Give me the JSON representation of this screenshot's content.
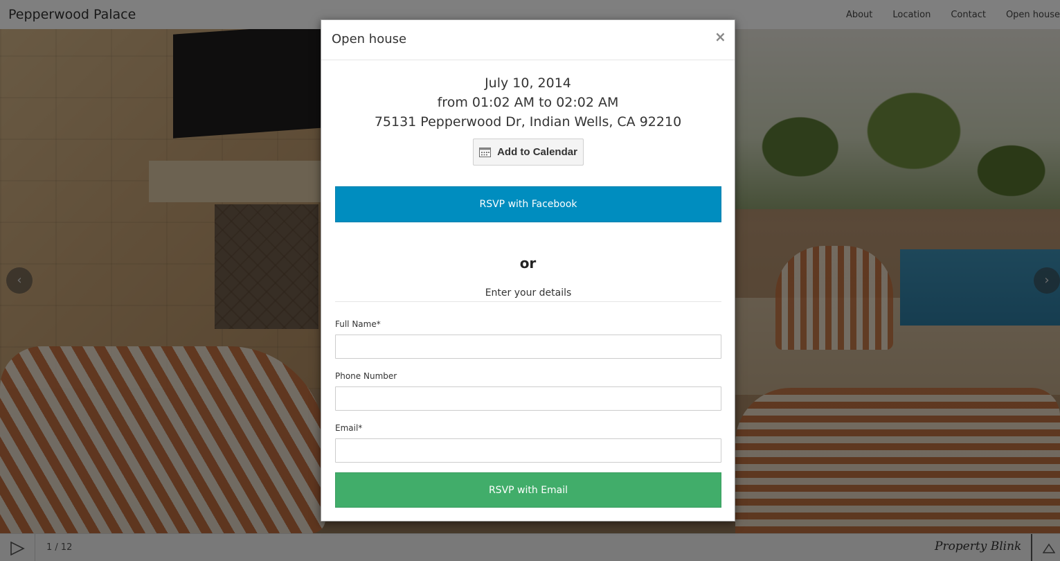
{
  "navbar": {
    "brand": "Pepperwood Palace",
    "links": [
      "About",
      "Location",
      "Contact",
      "Open house"
    ]
  },
  "slideshow": {
    "counter": "1 / 12",
    "brandmark": "Property Blink",
    "prev_icon": "chevron-left-icon",
    "next_icon": "chevron-right-icon"
  },
  "modal": {
    "title": "Open house",
    "close_symbol": "×",
    "date": "July 10, 2014",
    "time": "from 01:02 AM to 02:02 AM",
    "address": "75131 Pepperwood Dr, Indian Wells, CA 92210",
    "calendar_button": "Add to Calendar",
    "facebook_button": "RSVP with Facebook",
    "or_text": "or",
    "details_heading": "Enter your details",
    "fields": {
      "full_name": {
        "label": "Full Name*",
        "value": ""
      },
      "phone": {
        "label": "Phone Number",
        "value": ""
      },
      "email": {
        "label": "Email*",
        "value": ""
      }
    },
    "email_button": "RSVP with Email"
  },
  "colors": {
    "facebook_blue": "#008dbf",
    "email_green": "#41ad6a",
    "backdrop": "rgba(0,0,0,0.5)"
  }
}
